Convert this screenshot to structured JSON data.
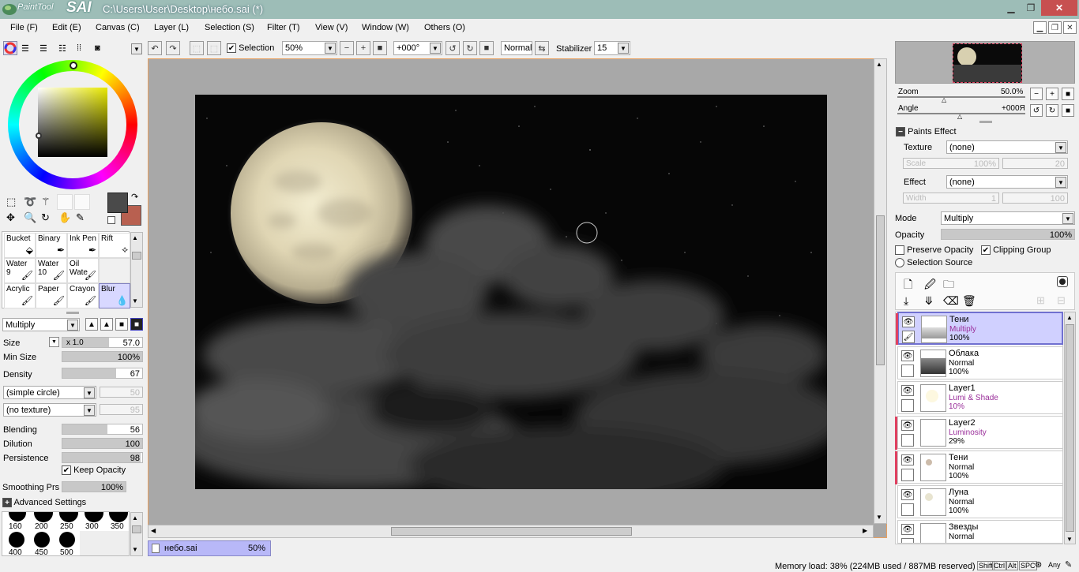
{
  "window": {
    "app_logo_small": "PaintTool",
    "app_logo_big": "SAI",
    "title": "C:\\Users\\User\\Desktop\\небо.sai (*)"
  },
  "menu": [
    "File (F)",
    "Edit (E)",
    "Canvas (C)",
    "Layer (L)",
    "Selection (S)",
    "Filter (T)",
    "View (V)",
    "Window (W)",
    "Others (O)"
  ],
  "toolbar": {
    "selection_label": "Selection",
    "zoom": "50%",
    "angle": "+000°",
    "blend": "Normal",
    "stabilizer_label": "Stabilizer",
    "stabilizer_value": "15"
  },
  "tools": {
    "brushes": [
      {
        "name": "Bucket",
        "size": ""
      },
      {
        "name": "Binary",
        "size": ""
      },
      {
        "name": "Ink Pen",
        "size": ""
      },
      {
        "name": "Rift",
        "size": ""
      },
      {
        "name": "Water",
        "size": "9"
      },
      {
        "name": "Water",
        "size": "10"
      },
      {
        "name": "Oil Wate",
        "size": ""
      },
      {
        "name": "",
        "size": ""
      },
      {
        "name": "Acrylic",
        "size": ""
      },
      {
        "name": "Paper",
        "size": ""
      },
      {
        "name": "Crayon",
        "size": ""
      },
      {
        "name": "Blur",
        "size": ""
      }
    ],
    "blend_mode": "Multiply",
    "size_label": "Size",
    "size_mult": "x 1.0",
    "size_value": "57.0",
    "min_size_label": "Min Size",
    "min_size_value": "100%",
    "density_label": "Density",
    "density_value": "67",
    "shape": "(simple circle)",
    "shape_value": "50",
    "texture": "(no texture)",
    "texture_value": "95",
    "blending_label": "Blending",
    "blending_value": "56",
    "dilution_label": "Dilution",
    "dilution_value": "100",
    "persistence_label": "Persistence",
    "persistence_value": "98",
    "keep_opacity_label": "Keep Opacity",
    "smoothing_label": "Smoothing Prs",
    "smoothing_value": "100%",
    "advanced_label": "Advanced Settings",
    "brush_sizes": [
      "160",
      "200",
      "250",
      "300",
      "350",
      "400",
      "450",
      "500"
    ]
  },
  "document_tab": {
    "name": "небо.sai",
    "zoom": "50%"
  },
  "navigator": {
    "zoom_label": "Zoom",
    "zoom_value": "50.0%",
    "angle_label": "Angle",
    "angle_value": "+000Я"
  },
  "paints_effect": {
    "header": "Paints Effect",
    "texture_label": "Texture",
    "texture_value": "(none)",
    "scale_label": "Scale",
    "scale_value": "100%",
    "scale_num": "20",
    "effect_label": "Effect",
    "effect_value": "(none)",
    "width_label": "Width",
    "width_value": "1",
    "width_num": "100"
  },
  "layer_props": {
    "mode_label": "Mode",
    "mode_value": "Multiply",
    "opacity_label": "Opacity",
    "opacity_value": "100%",
    "preserve_label": "Preserve Opacity",
    "clipping_label": "Clipping Group",
    "selection_source_label": "Selection Source"
  },
  "layers": [
    {
      "name": "Тени",
      "mode": "Multiply",
      "opacity": "100%"
    },
    {
      "name": "Облака",
      "mode": "Normal",
      "opacity": "100%"
    },
    {
      "name": "Layer1",
      "mode": "Lumi & Shade",
      "opacity": "10%"
    },
    {
      "name": "Layer2",
      "mode": "Luminosity",
      "opacity": "29%"
    },
    {
      "name": "Тени",
      "mode": "Normal",
      "opacity": "100%"
    },
    {
      "name": "Луна",
      "mode": "Normal",
      "opacity": "100%"
    },
    {
      "name": "Звезды",
      "mode": "Normal",
      "opacity": ""
    }
  ],
  "status": {
    "memory": "Memory load: 38% (224MB used / 887MB reserved)",
    "keys": [
      "Shift",
      "Ctrl",
      "Alt",
      "SPC",
      "Any"
    ]
  },
  "colors": {
    "primary": "#4a4a4a",
    "secondary": "#b86050",
    "active_layer": "#d0d0ff",
    "accent_pink": "#e04060"
  }
}
